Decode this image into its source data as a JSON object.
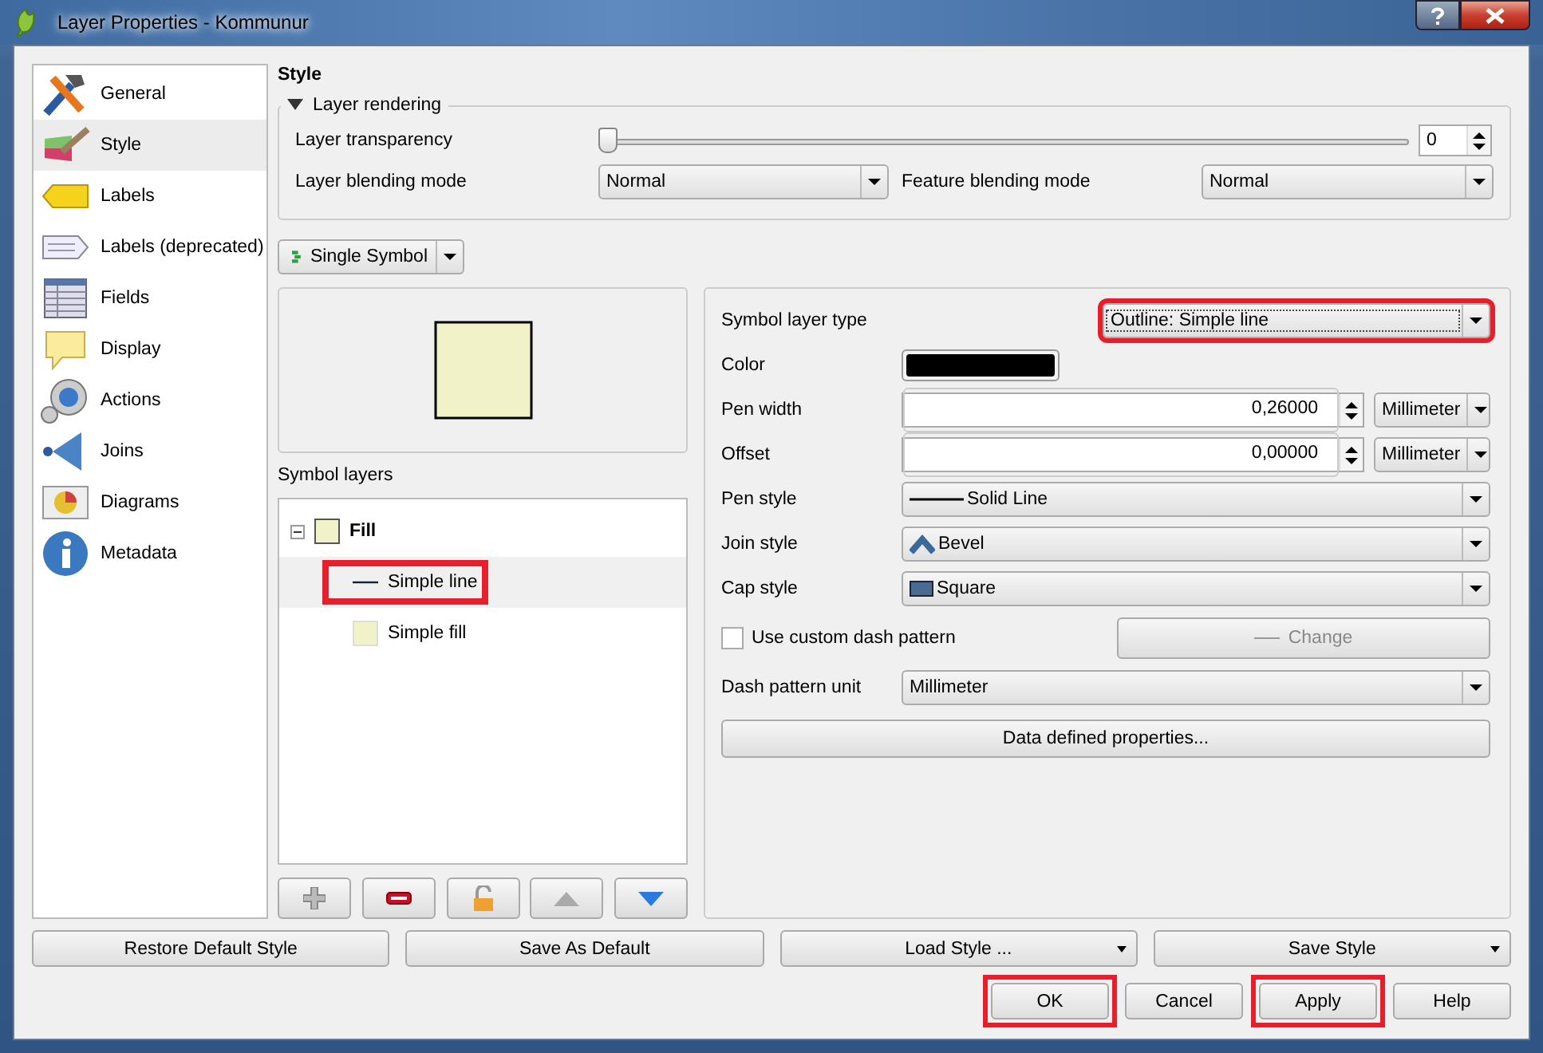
{
  "window": {
    "title": "Layer Properties - Kommunur"
  },
  "sidebar": {
    "items": [
      {
        "label": "General",
        "selected": false
      },
      {
        "label": "Style",
        "selected": true
      },
      {
        "label": "Labels",
        "selected": false
      },
      {
        "label": "Labels (deprecated)",
        "selected": false
      },
      {
        "label": "Fields",
        "selected": false
      },
      {
        "label": "Display",
        "selected": false
      },
      {
        "label": "Actions",
        "selected": false
      },
      {
        "label": "Joins",
        "selected": false
      },
      {
        "label": "Diagrams",
        "selected": false
      },
      {
        "label": "Metadata",
        "selected": false
      }
    ]
  },
  "style": {
    "title": "Style",
    "layer_rendering": {
      "title": "Layer rendering",
      "expanded": true,
      "transparency": {
        "label": "Layer transparency",
        "level": 0,
        "value": "0"
      },
      "layer_blending": {
        "label": "Layer blending mode",
        "value": "Normal"
      },
      "feature_blending": {
        "label": "Feature blending mode",
        "value": "Normal"
      }
    },
    "renderer": "Single Symbol",
    "symbol_layers_label": "Symbol layers",
    "tree": {
      "label": "Fill",
      "expanded": true,
      "children": [
        {
          "label": "Simple line",
          "kind": "line",
          "selected": true,
          "highlighted": true
        },
        {
          "label": "Simple fill",
          "kind": "fill",
          "selected": false,
          "highlighted": false
        }
      ]
    },
    "properties": [
      {
        "kind": "type",
        "label": "Symbol layer type",
        "value": "Outline: Simple line",
        "highlighted": true
      },
      {
        "kind": "color",
        "label": "Color",
        "color": "#000000"
      },
      {
        "kind": "spin",
        "label": "Pen width",
        "value": "0,26000",
        "unit": "Millimeter"
      },
      {
        "kind": "spin",
        "label": "Offset",
        "value": "0,00000",
        "unit": "Millimeter"
      },
      {
        "kind": "combo",
        "label": "Pen style",
        "value": "Solid Line"
      },
      {
        "kind": "combo",
        "label": "Join style",
        "value": "Bevel"
      },
      {
        "kind": "combo",
        "label": "Cap style",
        "value": "Square"
      },
      {
        "kind": "checkbox",
        "label": "Use custom dash pattern",
        "checked": false,
        "button": "Change",
        "button_disabled": true
      },
      {
        "kind": "combo",
        "label": "Dash pattern unit",
        "value": "Millimeter"
      },
      {
        "kind": "button",
        "label": "Data defined properties..."
      }
    ]
  },
  "style_buttons": [
    {
      "label": "Restore Default Style",
      "menu": false
    },
    {
      "label": "Save As Default",
      "menu": false
    },
    {
      "label": "Load Style ...",
      "menu": true
    },
    {
      "label": "Save Style",
      "menu": true
    }
  ],
  "dialog_buttons": [
    {
      "label": "OK",
      "highlighted": true
    },
    {
      "label": "Cancel",
      "highlighted": false
    },
    {
      "label": "Apply",
      "highlighted": true
    },
    {
      "label": "Help",
      "highlighted": false
    }
  ]
}
